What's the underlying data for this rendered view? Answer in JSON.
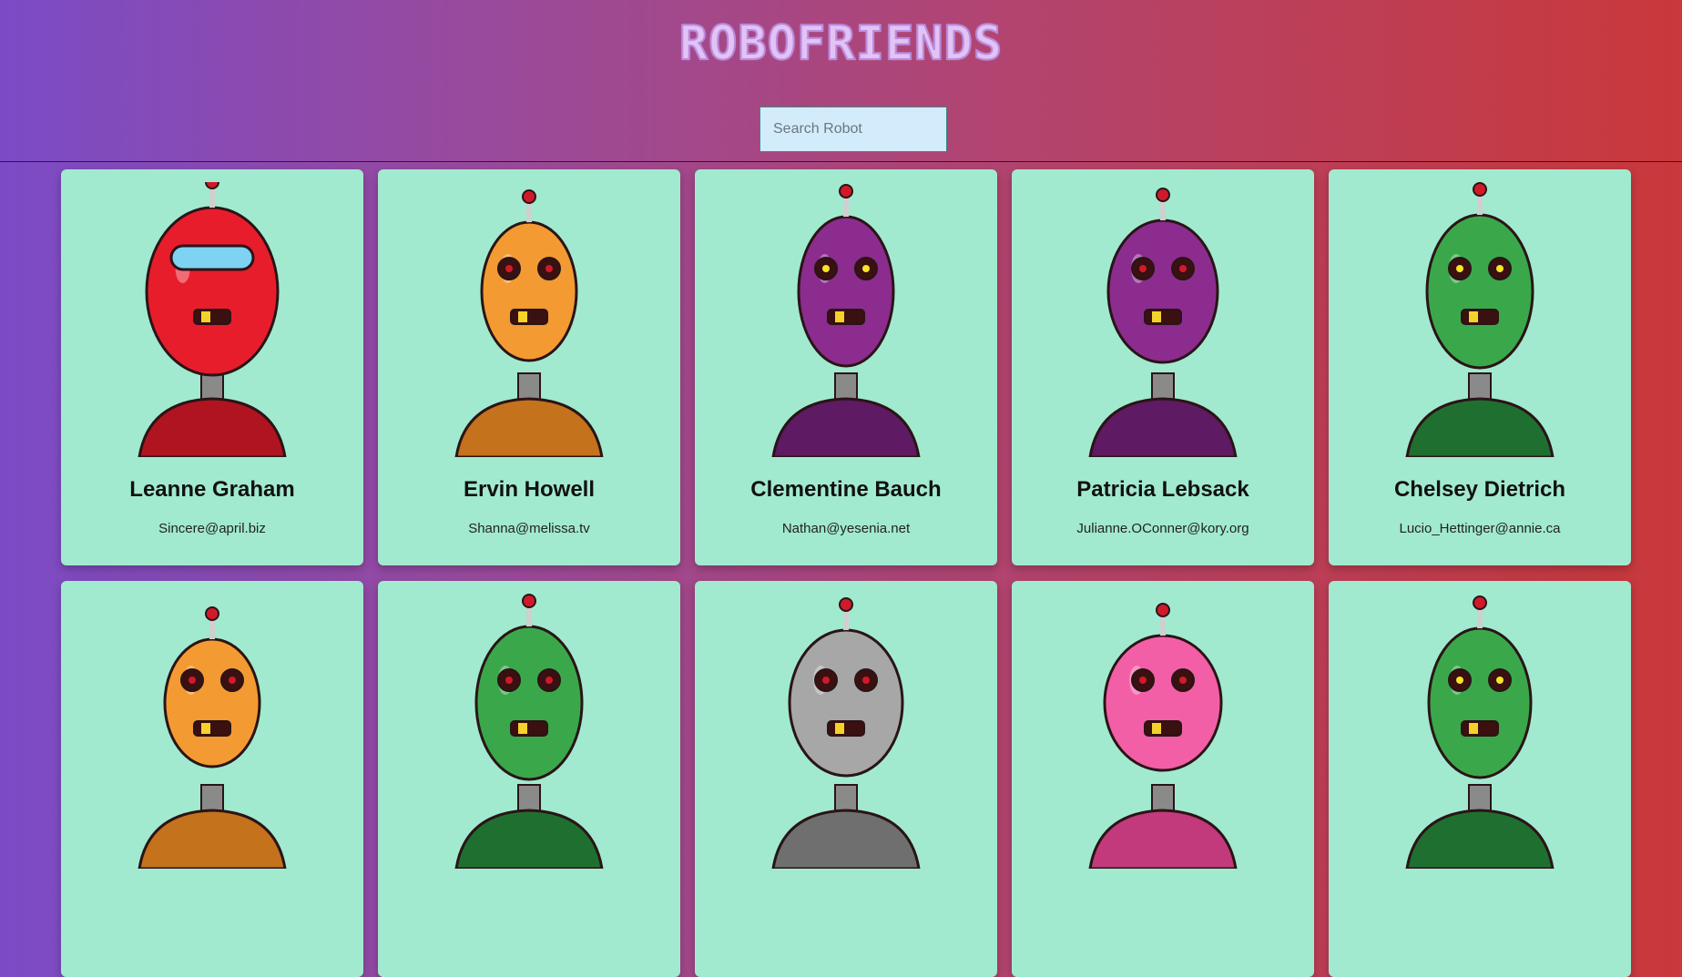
{
  "header": {
    "title": "ROBOFRIENDS",
    "search_placeholder": "Search Robot"
  },
  "robots": [
    {
      "name": "Leanne Graham",
      "email": "Sincere@april.biz",
      "color": "#e81d2c",
      "accent": "#b01420",
      "icon": "robot-avatar"
    },
    {
      "name": "Ervin Howell",
      "email": "Shanna@melissa.tv",
      "color": "#f39a32",
      "accent": "#c4721c",
      "icon": "robot-avatar"
    },
    {
      "name": "Clementine Bauch",
      "email": "Nathan@yesenia.net",
      "color": "#8b2c8e",
      "accent": "#5e1a62",
      "icon": "robot-avatar"
    },
    {
      "name": "Patricia Lebsack",
      "email": "Julianne.OConner@kory.org",
      "color": "#8c2c8f",
      "accent": "#5e1a62",
      "icon": "robot-avatar"
    },
    {
      "name": "Chelsey Dietrich",
      "email": "Lucio_Hettinger@annie.ca",
      "color": "#3aa84a",
      "accent": "#1f7030",
      "icon": "robot-avatar"
    },
    {
      "name": "",
      "email": "",
      "color": "#f39a32",
      "accent": "#c4721c",
      "icon": "robot-avatar"
    },
    {
      "name": "",
      "email": "",
      "color": "#3aa84a",
      "accent": "#1f7030",
      "icon": "robot-avatar"
    },
    {
      "name": "",
      "email": "",
      "color": "#a7a7a7",
      "accent": "#6f6f6f",
      "icon": "robot-avatar"
    },
    {
      "name": "",
      "email": "",
      "color": "#f35fa6",
      "accent": "#c23a7c",
      "icon": "robot-avatar"
    },
    {
      "name": "",
      "email": "",
      "color": "#3aa84a",
      "accent": "#1f7030",
      "icon": "robot-avatar"
    }
  ]
}
